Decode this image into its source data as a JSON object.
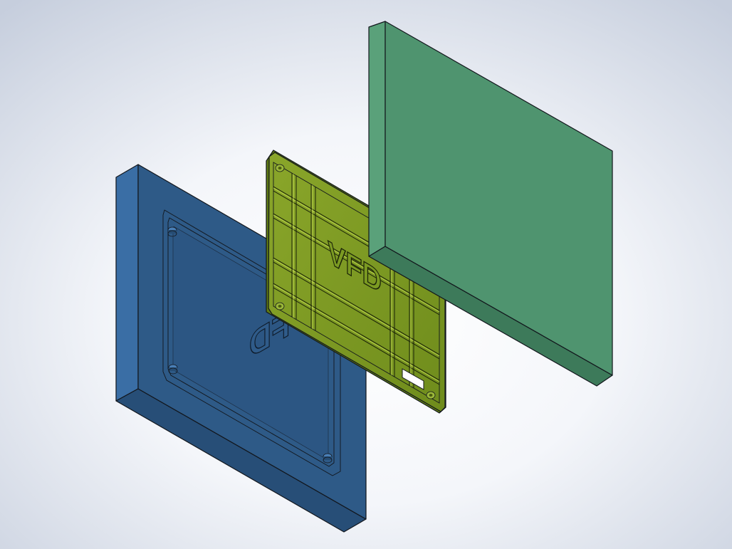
{
  "colors": {
    "background_center": "#ffffff",
    "background_edge": "#c6cedd",
    "mold_base_front": "#2e5a87",
    "mold_base_side": "#3a6ea5",
    "mold_base_bottom": "#274e77",
    "part_fill": "#7b9a22",
    "part_highlight": "#b7d34a",
    "cover_front": "#4f946f",
    "cover_side": "#5aa17a",
    "cover_bottom": "#3d7a5a"
  },
  "parts": [
    {
      "name": "mold-base",
      "engraved_text": "VFD"
    },
    {
      "name": "molded-panel",
      "embossed_text": "VFD"
    },
    {
      "name": "mold-cover"
    }
  ]
}
